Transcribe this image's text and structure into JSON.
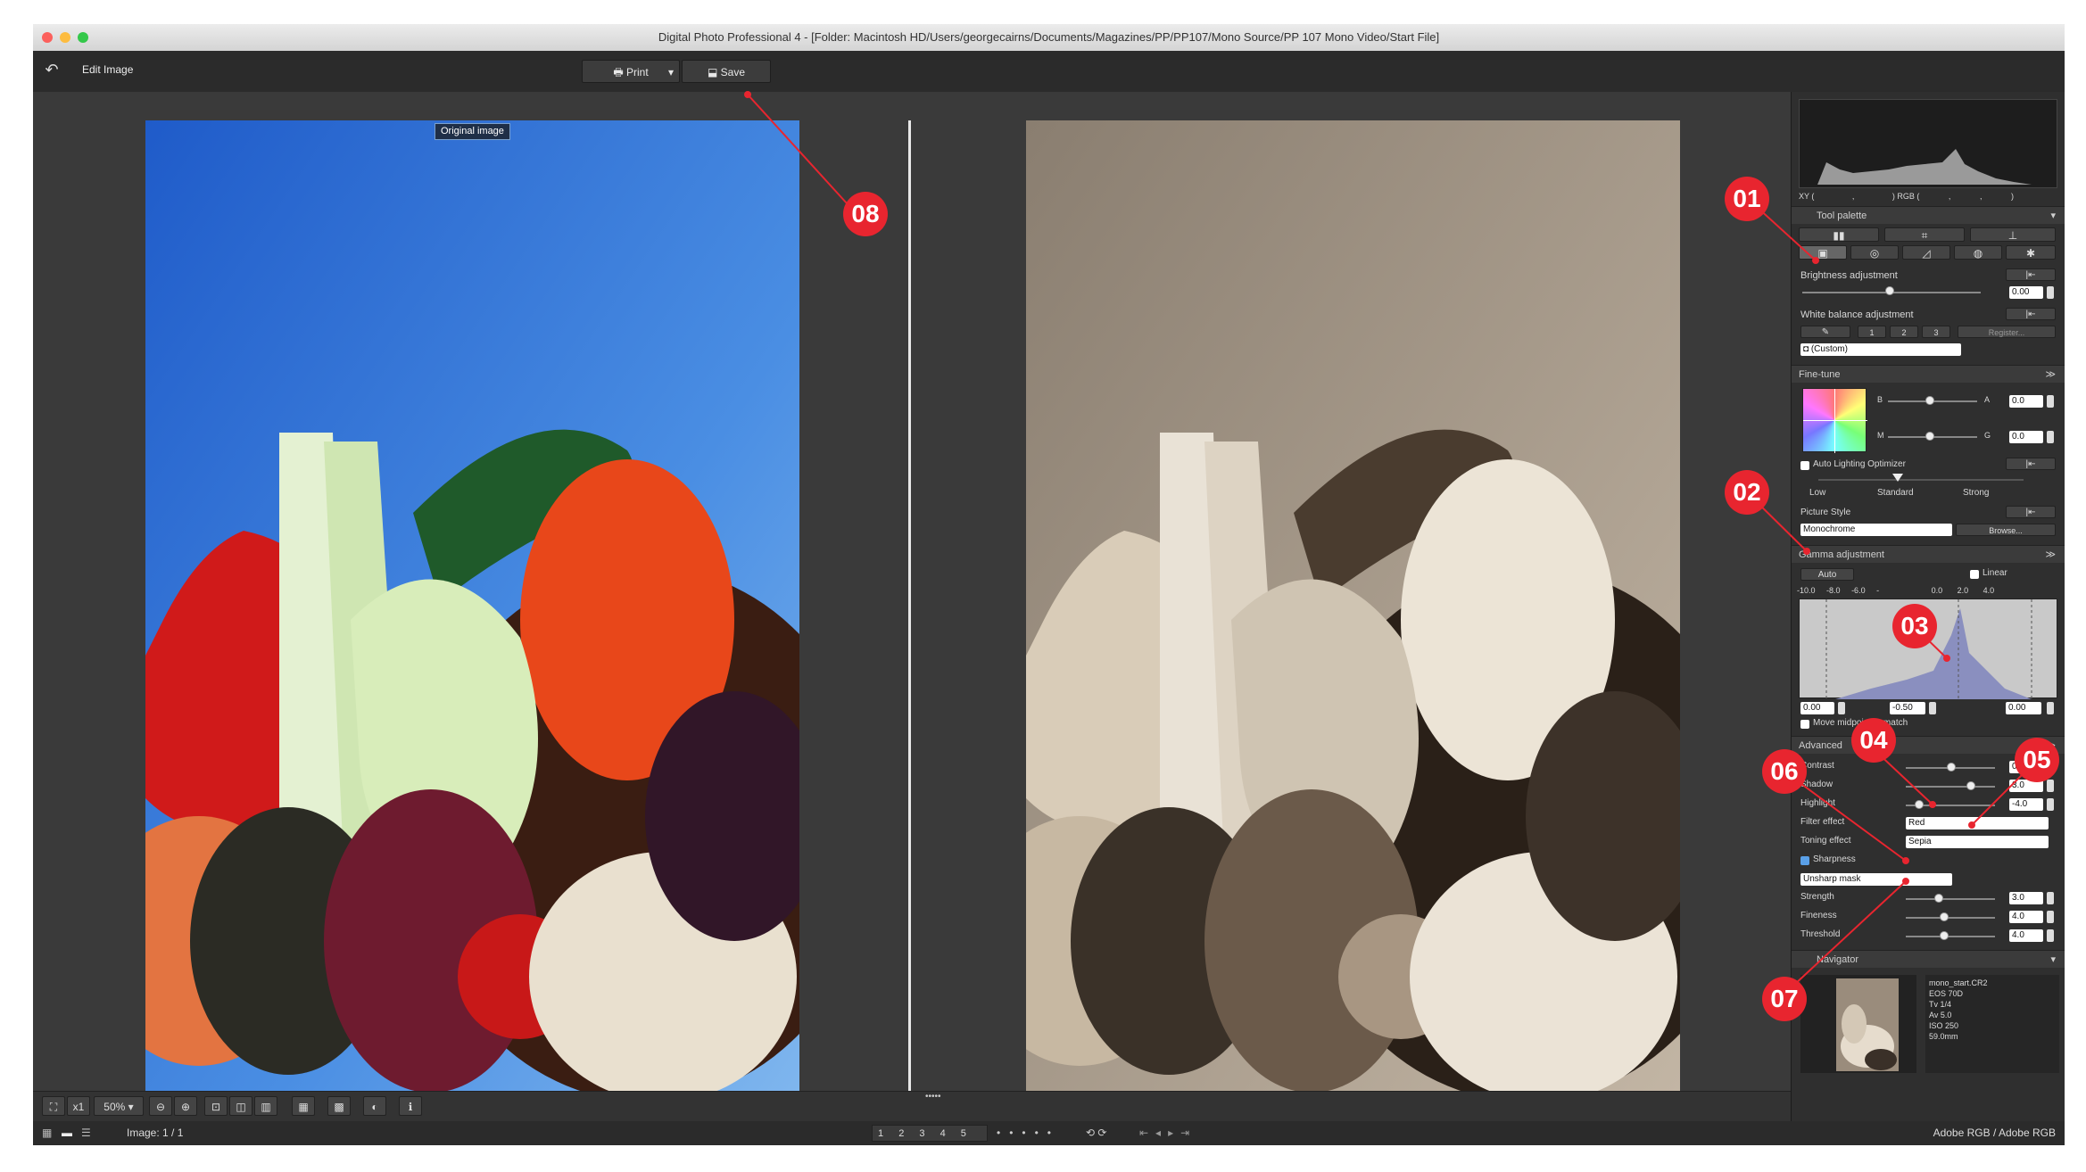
{
  "window": {
    "title": "Digital Photo Professional 4 - [Folder: Macintosh HD/Users/georgecairns/Documents/Magazines/PP/PP107/Mono Source/PP 107 Mono Video/Start File]"
  },
  "toolbar": {
    "back_icon": "undo-arrow-icon",
    "edit_label": "Edit Image",
    "print_label": "Print",
    "save_label": "Save"
  },
  "viewer": {
    "original_label": "Original image"
  },
  "bottom": {
    "zoom_x1": "x1",
    "zoom_level": "50%",
    "image_count": "Image: 1 / 1",
    "color_space": "Adobe RGB / Adobe RGB",
    "ratings": [
      "1",
      "2",
      "3",
      "4",
      "5"
    ]
  },
  "histogram": {
    "xy_label": "XY (",
    "comma": ",",
    "rgb_label": ") RGB (",
    "comma2": ",",
    "comma3": ",",
    "end": ")"
  },
  "tool_palette": {
    "title": "Tool palette",
    "brightness": {
      "label": "Brightness adjustment",
      "value": "0.00"
    },
    "white_balance": {
      "label": "White balance adjustment",
      "buttons": [
        "1",
        "2",
        "3"
      ],
      "register": "Register...",
      "preset": "(Custom)"
    },
    "fine_tune": {
      "title": "Fine-tune",
      "b_label": "B",
      "a_label": "A",
      "a_value": "0.0",
      "m_label": "M",
      "g_label": "G",
      "g_value": "0.0",
      "alo_label": "Auto Lighting Optimizer",
      "low": "Low",
      "standard": "Standard",
      "strong": "Strong",
      "picture_style_label": "Picture Style",
      "picture_style_value": "Monochrome",
      "browse": "Browse..."
    },
    "gamma": {
      "title": "Gamma adjustment",
      "auto": "Auto",
      "linear": "Linear",
      "scale": [
        "-10.0",
        "-8.0",
        "-6.0",
        "-",
        "0.0",
        "2.0",
        "4.0"
      ],
      "black": "0.00",
      "mid_value": "-0.50",
      "white": "0.00",
      "move_midpoint": "Move midpoint to match"
    },
    "advanced": {
      "title": "Advanced",
      "contrast": {
        "label": "Contrast",
        "value": "0.0"
      },
      "shadow": {
        "label": "Shadow",
        "value": "3.0"
      },
      "highlight": {
        "label": "Highlight",
        "value": "-4.0"
      },
      "filter_effect": {
        "label": "Filter effect",
        "value": "Red"
      },
      "toning_effect": {
        "label": "Toning effect",
        "value": "Sepia"
      },
      "sharpness": {
        "label": "Sharpness",
        "mode": "Unsharp mask"
      },
      "strength": {
        "label": "Strength",
        "value": "3.0"
      },
      "fineness": {
        "label": "Fineness",
        "value": "4.0"
      },
      "threshold": {
        "label": "Threshold",
        "value": "4.0"
      }
    },
    "navigator": {
      "title": "Navigator",
      "info": [
        "mono_start.CR2",
        "EOS 70D",
        "Tv 1/4",
        "Av 5.0",
        "ISO 250",
        "59.0mm"
      ]
    }
  },
  "annotations": [
    "01",
    "02",
    "03",
    "04",
    "05",
    "06",
    "07",
    "08"
  ],
  "colors": {
    "marker": "#e8252f",
    "panel_bg": "#2f2f2f",
    "sky_blue": "#3f7fd6",
    "sepia": "#b9aa98"
  }
}
